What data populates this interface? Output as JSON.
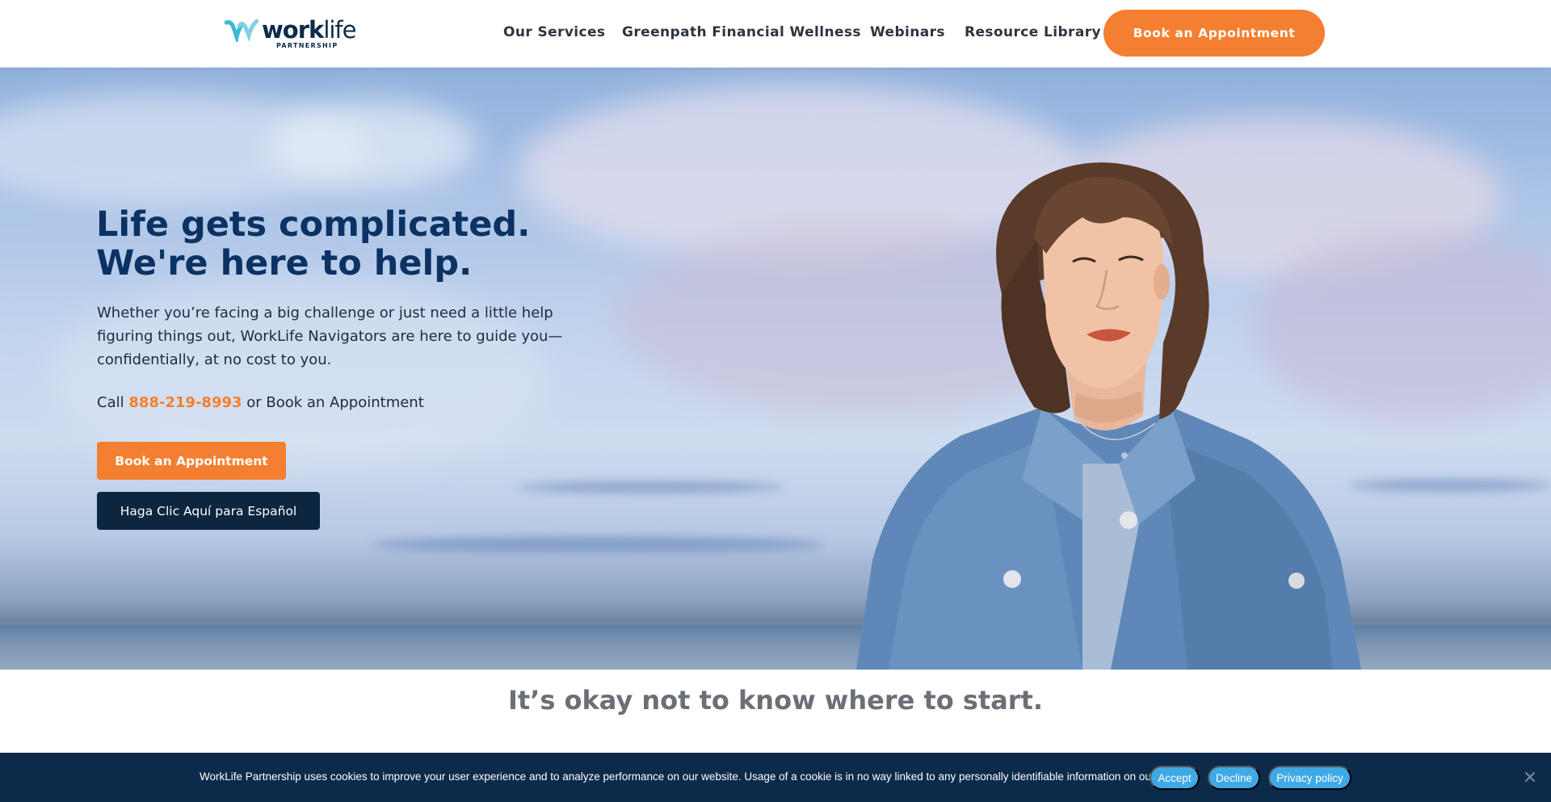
{
  "header": {
    "logo": {
      "word_bold": "work",
      "word_light": "life",
      "sub": "PARTNERSHIP"
    },
    "nav": [
      {
        "label": "Our Services"
      },
      {
        "label": "Greenpath Financial Wellness"
      },
      {
        "label": "Webinars"
      },
      {
        "label": "Resource Library"
      }
    ],
    "cta_label": "Book an Appointment"
  },
  "hero": {
    "title_line1": "Life gets complicated.",
    "title_line2": "We're here to help.",
    "body": "Whether you’re facing a big challenge or just need a little help figuring things out, WorkLife Navigators are here to guide you—confidentially, at no cost to you.",
    "call_prefix": "Call ",
    "phone": "888-219-8993",
    "call_suffix": " or Book an Appointment",
    "book_button": "Book an Appointment",
    "spanish_button": "Haga Clic Aquí para Español"
  },
  "section": {
    "title": "It’s okay not to know where to start."
  },
  "cookie_bar": {
    "text": "WorkLife Partnership uses cookies to improve your user experience and to analyze performance on our website. Usage of a cookie is in no way linked to any personally identifiable information on our site.",
    "accept": "Accept",
    "decline": "Decline",
    "privacy": "Privacy policy"
  },
  "colors": {
    "brand_orange": "#f47f30",
    "brand_navy": "#0c3263",
    "cookie_bg": "#0c2a4a",
    "cookie_button": "#3fa9e6",
    "logo_teal": "#3fb8d6"
  },
  "icons": {
    "logo": "worklife-logo-icon",
    "close": "close-icon"
  }
}
